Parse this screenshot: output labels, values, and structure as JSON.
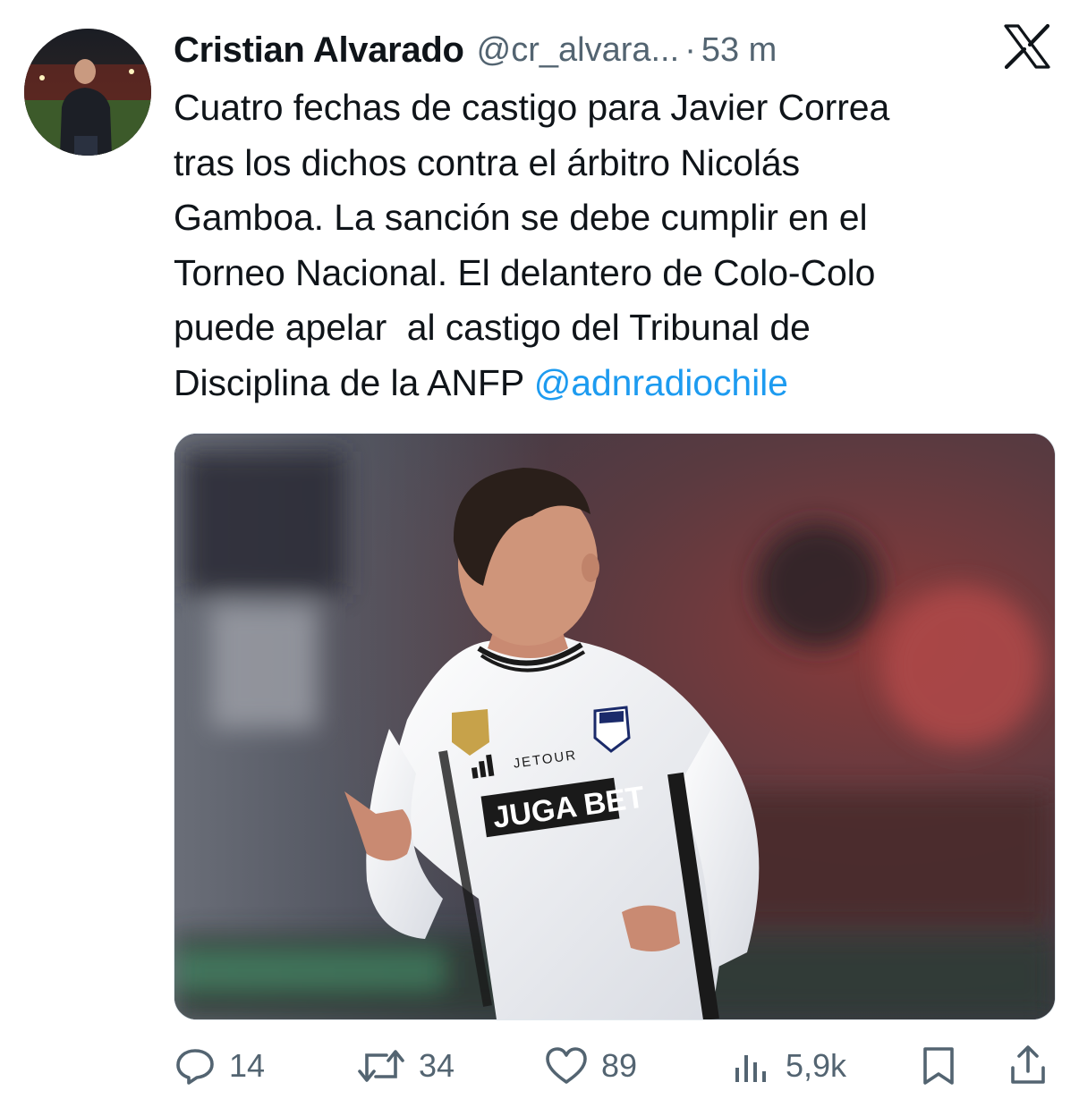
{
  "author": {
    "name": "Cristian Alvarado",
    "handle": "@cr_alvara...",
    "separator": "·",
    "time": "53 m"
  },
  "tweet": {
    "text": "Cuatro fechas de castigo para Javier Correa\ntras los dichos contra el árbitro Nicolás\nGamboa. La sanción se debe cumplir en el\nTorneo Nacional. El delantero de Colo-Colo\npuede apelar  al castigo del Tribunal de\nDisciplina de la ANFP ",
    "mention": "@adnradiochile"
  },
  "media": {
    "jersey_sponsor": "JUGA BET",
    "jersey_brand": "JETOUR"
  },
  "actions": {
    "replies": "14",
    "reposts": "34",
    "likes": "89",
    "views": "5,9k"
  },
  "colors": {
    "text": "#0f1419",
    "secondary": "#536471",
    "link": "#1d9bf0"
  },
  "icons": [
    "x-logo-icon",
    "reply-icon",
    "repost-icon",
    "like-icon",
    "views-icon",
    "bookmark-icon",
    "share-icon"
  ]
}
